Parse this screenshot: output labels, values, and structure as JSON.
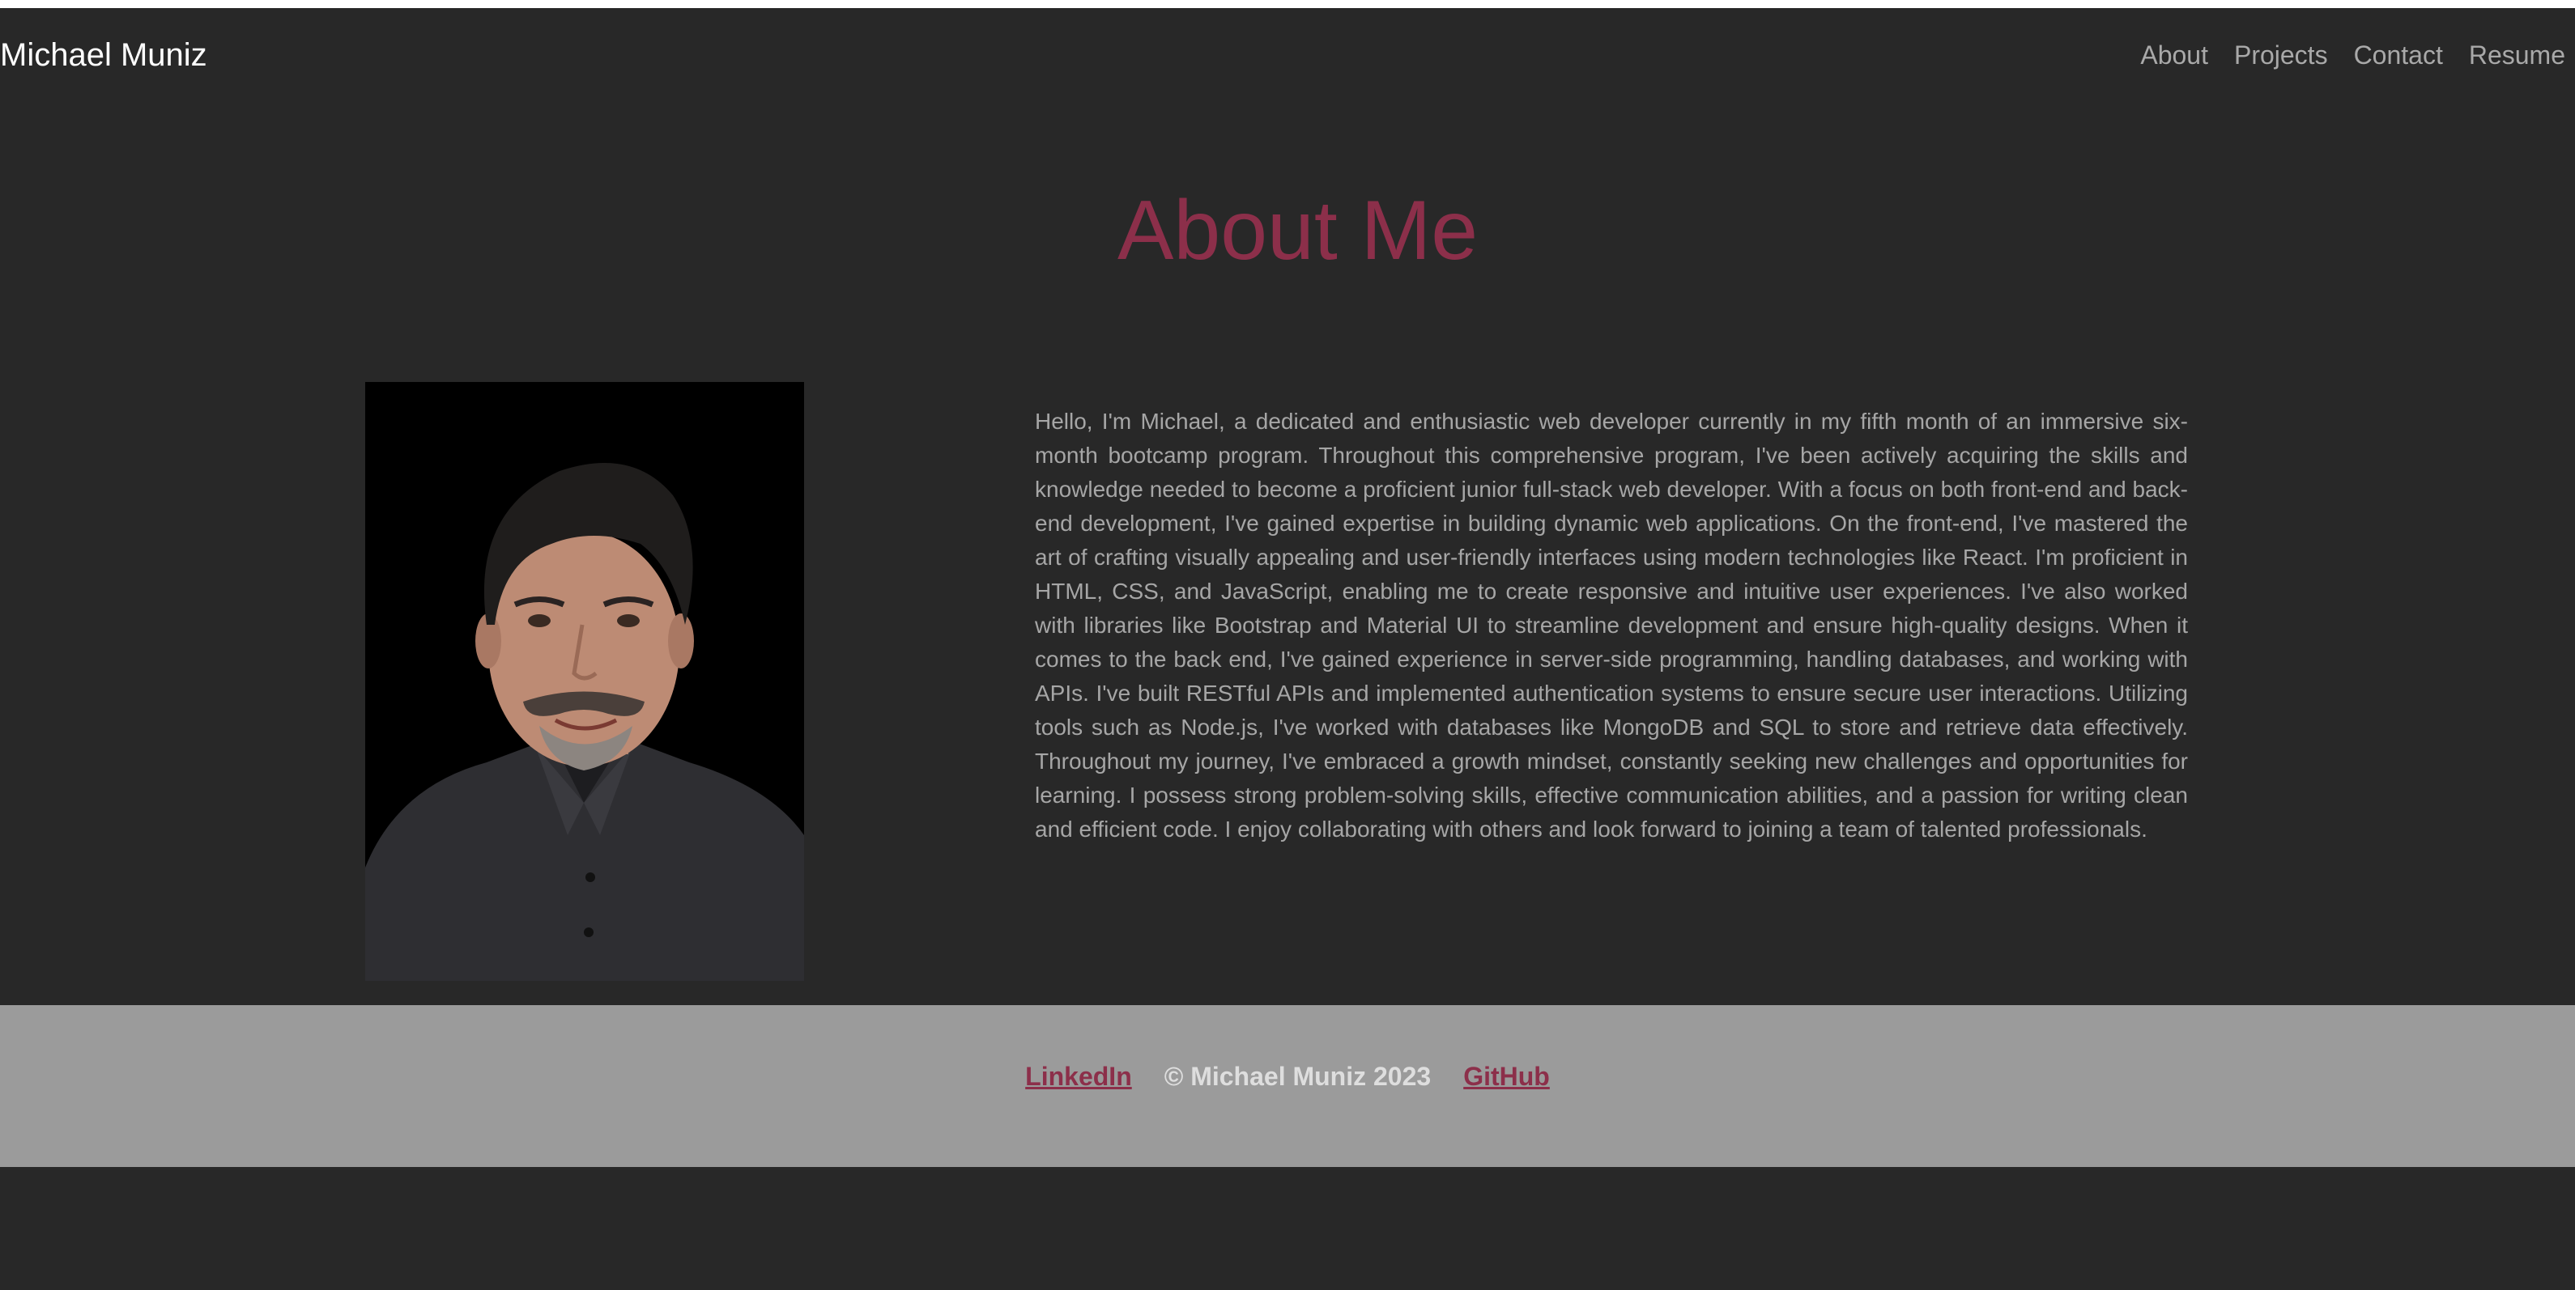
{
  "header": {
    "brand": "Michael Muniz",
    "nav": [
      "About",
      "Projects",
      "Contact",
      "Resume"
    ]
  },
  "about": {
    "title": "About Me",
    "text": "Hello, I'm Michael, a dedicated and enthusiastic web developer currently in my fifth month of an immersive six-month bootcamp program. Throughout this comprehensive program, I've been actively acquiring the skills and knowledge needed to become a proficient junior full-stack web developer. With a focus on both front-end and back-end development, I've gained expertise in building dynamic web applications. On the front-end, I've mastered the art of crafting visually appealing and user-friendly interfaces using modern technologies like React. I'm proficient in HTML, CSS, and JavaScript, enabling me to create responsive and intuitive user experiences. I've also worked with libraries like Bootstrap and Material UI to streamline development and ensure high-quality designs. When it comes to the back end, I've gained experience in server-side programming, handling databases, and working with APIs. I've built RESTful APIs and implemented authentication systems to ensure secure user interactions. Utilizing tools such as Node.js, I've worked with databases like MongoDB and SQL to store and retrieve data effectively. Throughout my journey, I've embraced a growth mindset, constantly seeking new challenges and opportunities for learning. I possess strong problem-solving skills, effective communication abilities, and a passion for writing clean and efficient code. I enjoy collaborating with others and look forward to joining a team of talented professionals."
  },
  "footer": {
    "linkedin": "LinkedIn",
    "copyright": "© Michael Muniz 2023",
    "github": "GitHub"
  },
  "colors": {
    "background": "#282828",
    "accent": "#8c2f4a",
    "footer_bg": "#9b9b9b",
    "body_text": "#a6a6a6"
  }
}
